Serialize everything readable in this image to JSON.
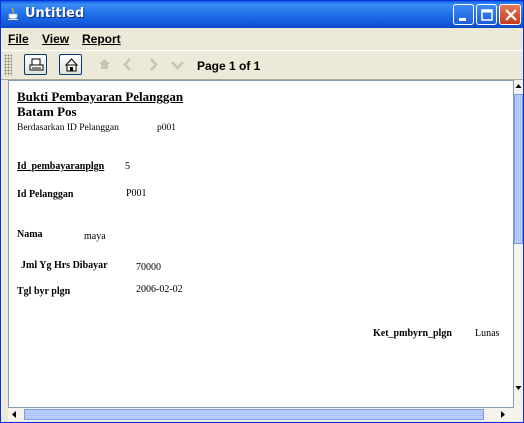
{
  "window": {
    "title": "Untitled"
  },
  "menu": {
    "file": "File",
    "view": "View",
    "report": "Report"
  },
  "toolbar": {
    "page_label": "Page 1 of 1"
  },
  "report": {
    "title": "Bukti Pembayaran  Pelanggan",
    "subtitle": "Batam Pos",
    "filter_label": "Berdasarkan ID Pelanggan",
    "filter_value": "p001",
    "fields": {
      "id_pembayaran_label": "Id_pembayaranplgn",
      "id_pembayaran_value": "5",
      "id_pelanggan_label": "Id Pelanggan",
      "id_pelanggan_value": "P001",
      "nama_label": "Nama",
      "nama_value": "maya",
      "jml_label": "Jml  Yg Hrs Dibayar",
      "jml_value": "70000",
      "tgl_label": "Tgl byr plgn",
      "tgl_value": "2006-02-02",
      "ket_label": "Ket_pmbyrn_plgn",
      "ket_value": "Lunas"
    }
  },
  "icons": {
    "app": "java-cup-icon",
    "print": "printer-icon",
    "export": "export-icon",
    "first": "first-page-icon",
    "prev": "previous-page-icon",
    "next": "next-page-icon",
    "last": "last-page-icon"
  }
}
